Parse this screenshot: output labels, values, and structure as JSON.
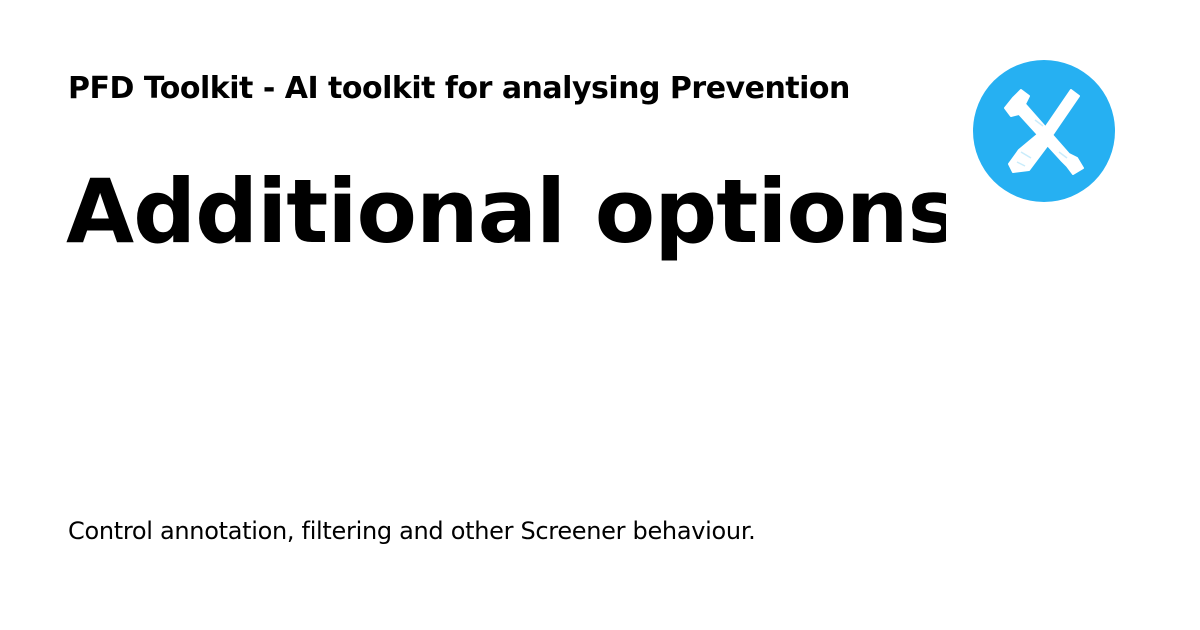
{
  "site": {
    "title": "PFD Toolkit - AI toolkit for analysing Prevention"
  },
  "page": {
    "title": "Additional options",
    "description": "Control annotation, filtering and other Screener behaviour."
  },
  "logo": {
    "icon": "tools-icon",
    "background_color": "#26b0f2",
    "glyph_color": "#ffffff"
  }
}
